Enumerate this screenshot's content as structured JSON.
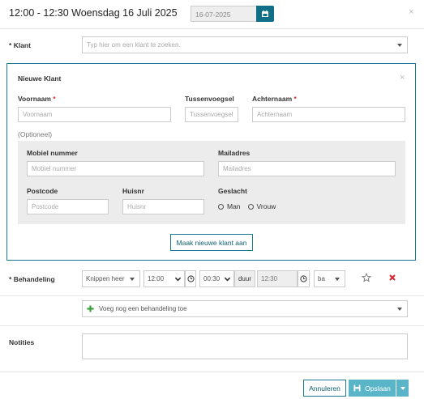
{
  "header": {
    "title": "12:00 - 12:30 Woensdag 16 Juli 2025",
    "date_value": "16-07-2025"
  },
  "klant": {
    "label": "Klant",
    "required_mark": "*",
    "placeholder": "Typ hier om een klant te zoeken."
  },
  "nieuwe_klant": {
    "title": "Nieuwe Klant",
    "voornaam_label": "Voornaam",
    "voornaam_placeholder": "Voornaam",
    "tussenvoegsel_label": "Tussenvoegsel",
    "tussenvoegsel_placeholder": "Tussenvoegsel",
    "achternaam_label": "Achternaam",
    "achternaam_placeholder": "Achternaam",
    "optional_label": "(Optioneel)",
    "mobiel_label": "Mobiel nummer",
    "mobiel_placeholder": "Mobiel nummer",
    "mail_label": "Mailadres",
    "mail_placeholder": "Mailadres",
    "postcode_label": "Postcode",
    "postcode_placeholder": "Postcode",
    "huisnr_label": "Huisnr",
    "huisnr_placeholder": "Huisnr",
    "geslacht_label": "Geslacht",
    "gender_options": [
      "Man",
      "Vrouw"
    ],
    "create_button": "Maak nieuwe klant aan"
  },
  "behandeling": {
    "label": "Behandeling",
    "required_mark": "*",
    "treatment_value": "Knippen heer",
    "start_time": "12:00",
    "duration_value": "00:30",
    "duration_label": "duur",
    "end_time": "12:30",
    "staff_value": "ba",
    "add_placeholder": "Voeg nog een behandeling toe"
  },
  "notities": {
    "label": "Notities"
  },
  "footer": {
    "cancel_label": "Annuleren",
    "save_label": "Opslaan"
  },
  "colors": {
    "primary": "#0e6f86",
    "save_button": "#5bb5c8",
    "required": "#c9302c",
    "add_icon": "#3aa03a",
    "remove_icon": "#d9232d"
  }
}
